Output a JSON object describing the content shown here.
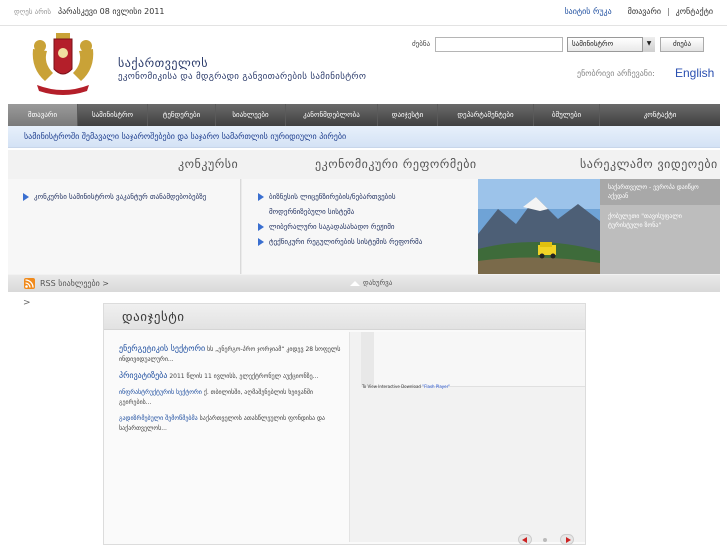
{
  "topbar": {
    "date_label": "დღეს არის",
    "date_value": "პარასკევი 08 ივლისი 2011",
    "links": [
      "საიტის რუკა",
      "მთავარი",
      "კონტაქტი"
    ]
  },
  "header": {
    "title_line1": "საქართველოს",
    "title_line2": "ეკონომიკისა და მდგრადი განვითარების სამინისტრო",
    "search_label": "ძებნა",
    "search_value": "",
    "search_scope": "სამინისტრო",
    "search_button": "ძიება",
    "lang_label": "ენობრივი არჩევანი:",
    "lang_link": "English"
  },
  "nav": {
    "items": [
      "მთავარი",
      "სამინისტრო",
      "ტენდერები",
      "სიახლეები",
      "კანონმდებლობა",
      "დაიჯესტი",
      "დეპარტამენტები",
      "ბმულები",
      "კონტაქტი"
    ]
  },
  "subbar": {
    "text": "სამინისტროში შემავალი საჯაროშებები და საჯარო სამართლის იურიდიული პირები"
  },
  "feature": {
    "heading1": "კონკურსი",
    "heading2": "ეკონომიკური რეფორმები",
    "heading3": "სარეკლამო ვიდეოები",
    "contest_item": "კონკურსი სამინისტროს ვაკანტურ თანამდებობებზე",
    "reforms": [
      "ბიზნესის ლიცენზირების/ნებართვების",
      "მოდერნიზებული სისტემა",
      "ლიბერალური საგადასახადო რეჟიმი",
      "ტექნიკური რეგულირების სისტემის რეფორმა"
    ],
    "videos": [
      "საქართველო - ევროპა დაიწყო აქედან",
      "ქობულეთი \"თავისუფალი ტურისტული ზონა\""
    ]
  },
  "rssbar": {
    "rss_text": "RSS სიახლეები >",
    "collapse_text": "დახურვა"
  },
  "gt_mark": ">",
  "digest": {
    "title": "დაიჯესტი",
    "items": [
      {
        "key": "ენერგეტიკის სექტორი",
        "text": "სს „ენერგო-პრო ჯორჯიამ“ კიდევ 28 სოფელს ინდივიდუალური..."
      },
      {
        "key": "პრივატიზება",
        "text": "2011 წლის 11 ივლისს, ელექტრონულ აუქციონზე..."
      },
      {
        "key": "ინფრასტრუქტურის სექტორი",
        "text": "ქ. თბილისში, აღმაშენებლის ხეივანში გეირების..."
      },
      {
        "key": "გადიზრმებული შემოწმებმა",
        "text": "საქართველოს ათასწლეულის ფონდისა და საქართველოს..."
      }
    ],
    "flash_note_prefix": "To View Interactive Download",
    "flash_note_link": "\"Flash Player\""
  },
  "colors": {
    "nav_bg": "#4f4f4f",
    "link_blue": "#1f4fa0",
    "pager_arrow": "#cc2222"
  }
}
